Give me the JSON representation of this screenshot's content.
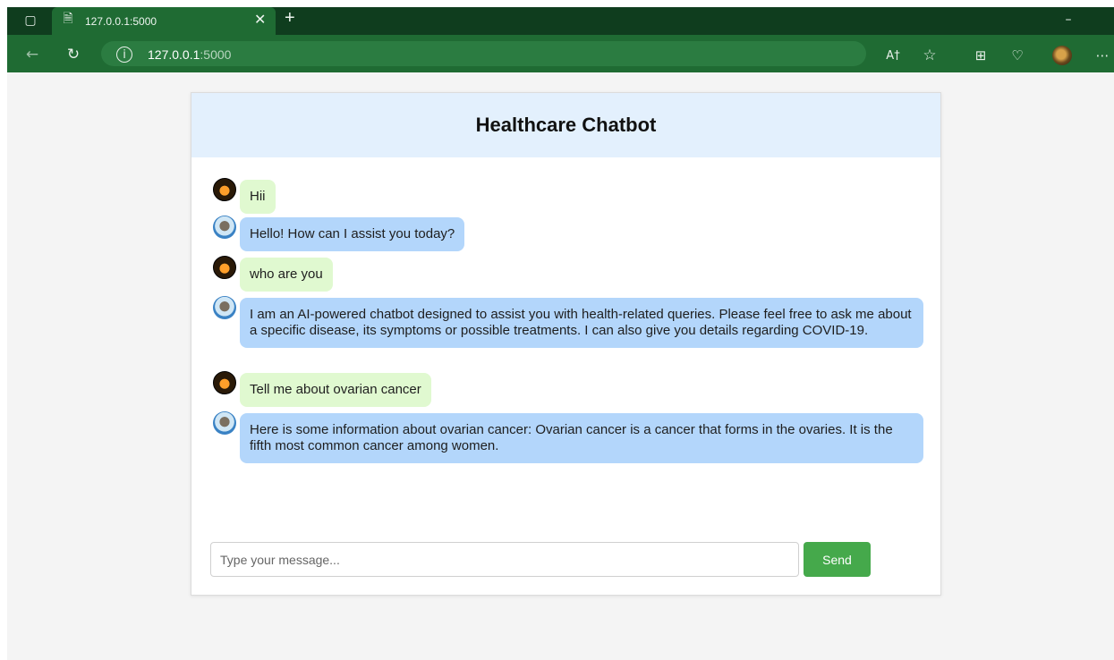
{
  "browser": {
    "tab_title": "127.0.0.1:5000",
    "url_host": "127.0.0.1",
    "url_port": ":5000",
    "icons": [
      "sidebar-icon",
      "page-icon",
      "close-icon",
      "new-tab-icon",
      "back-icon",
      "reload-icon",
      "info-icon",
      "read-aloud-icon",
      "favorite-icon",
      "collections-icon",
      "health-icon",
      "profile-avatar",
      "more-icon",
      "minimize-icon"
    ]
  },
  "chat": {
    "title": "Healthcare Chatbot",
    "messages": [
      {
        "role": "user",
        "text": "Hii"
      },
      {
        "role": "bot",
        "text": "Hello! How can I assist you today?"
      },
      {
        "role": "user",
        "text": "who are you"
      },
      {
        "role": "bot",
        "text": "I am an AI-powered chatbot designed to assist you with health-related queries. Please feel free to ask me about a specific disease, its symptoms or possible treatments. I can also give you details regarding COVID-19."
      },
      {
        "role": "user",
        "text": "Tell me about ovarian cancer"
      },
      {
        "role": "bot",
        "text": "Here is some information about ovarian cancer: Ovarian cancer is a cancer that forms in the ovaries. It is the fifth most common cancer among women."
      }
    ],
    "input_placeholder": "Type your message...",
    "send_label": "Send"
  },
  "colors": {
    "browser_frame": "#1f6b33",
    "header_bg": "#e3f0fd",
    "user_bubble": "#e0f9d0",
    "bot_bubble": "#b3d6fb",
    "send_button": "#45a94b"
  }
}
